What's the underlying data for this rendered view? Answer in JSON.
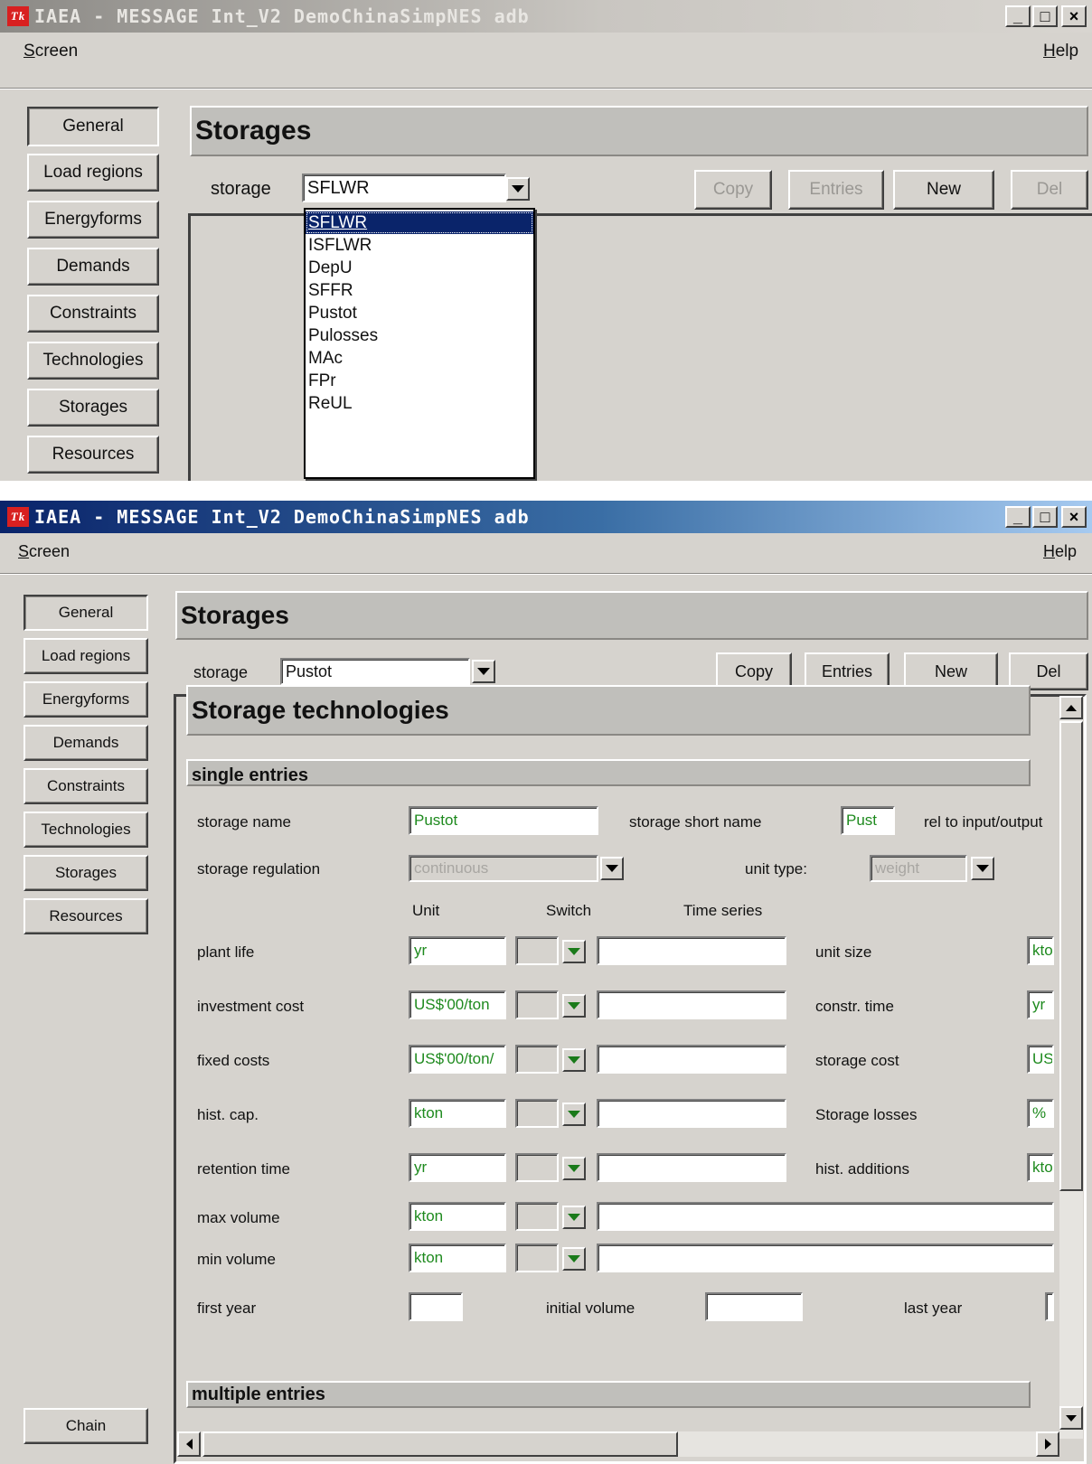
{
  "window_title": "IAEA - MESSAGE Int_V2 DemoChinaSimpNES adb",
  "tk_logo": "Tk",
  "window_controls": {
    "minimize": "_",
    "maximize": "□",
    "close": "×"
  },
  "menu": {
    "screen_letter": "S",
    "screen_rest": "creen",
    "help_letter": "H",
    "help_rest": "elp"
  },
  "nav": {
    "items": [
      "General",
      "Load regions",
      "Energyforms",
      "Demands",
      "Constraints",
      "Technologies",
      "Storages",
      "Resources"
    ],
    "chain": "Chain"
  },
  "page_title": "Storages",
  "toolbar": {
    "storage_label": "storage",
    "copy": "Copy",
    "entries": "Entries",
    "new": "New",
    "del": "Del"
  },
  "top": {
    "storage_value": "SFLWR",
    "dropdown_options": [
      "SFLWR",
      "ISFLWR",
      "DepU",
      "SFFR",
      "Pustot",
      "Pulosses",
      "MAc",
      "FPr",
      "ReUL"
    ],
    "selected_index": 0
  },
  "bottom": {
    "storage_value": "Pustot",
    "section_title": "Storage technologies",
    "single_entries": "single entries",
    "multiple_entries": "multiple entries",
    "storage_name_label": "storage name",
    "storage_name_value": "Pustot",
    "short_name_label": "storage short name",
    "short_name_value": "Pust",
    "rel_label": "rel to input/output",
    "regulation_label": "storage regulation",
    "regulation_value": "continuous",
    "unit_type_label": "unit type:",
    "unit_type_value": "weight",
    "col_unit": "Unit",
    "col_switch": "Switch",
    "col_timeseries": "Time series",
    "params": [
      {
        "label": "plant life",
        "unit": "yr"
      },
      {
        "label": "investment cost",
        "unit": "US$'00/ton"
      },
      {
        "label": "fixed costs",
        "unit": "US$'00/ton/"
      },
      {
        "label": "hist. cap.",
        "unit": "kton"
      },
      {
        "label": "retention time",
        "unit": "yr"
      },
      {
        "label": "max volume",
        "unit": "kton"
      },
      {
        "label": "min volume",
        "unit": "kton"
      }
    ],
    "right_params": [
      {
        "label": "unit size",
        "unit": "kto"
      },
      {
        "label": "constr. time",
        "unit": "yr"
      },
      {
        "label": "storage cost",
        "unit": "US"
      },
      {
        "label": "Storage losses",
        "unit": "%"
      },
      {
        "label": "hist. additions",
        "unit": "kto"
      }
    ],
    "first_year_label": "first year",
    "initial_volume_label": "initial volume",
    "last_year_label": "last year"
  },
  "colors": {
    "title_active": "#0a246a",
    "field_green_text": "#1e8a1e",
    "selection": "#0a246a",
    "face": "#d6d3ce"
  }
}
